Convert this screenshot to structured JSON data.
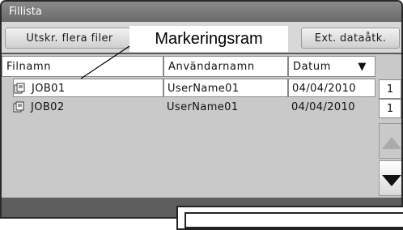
{
  "window": {
    "title": "Fillista"
  },
  "tabs": [
    {
      "label": "Utskr. flera filer"
    },
    {
      "label": "Ext. dataåtk."
    }
  ],
  "annotation": {
    "label": "Markeringsram"
  },
  "table": {
    "columns": [
      "Filnamn",
      "Användarnamn",
      "Datum"
    ],
    "sort_indicator": "▼",
    "rows": [
      {
        "filename": "JOB01",
        "user": "UserName01",
        "date": "04/04/2010",
        "selected": true
      },
      {
        "filename": "JOB02",
        "user": "UserName01",
        "date": "04/04/2010",
        "selected": false
      }
    ]
  },
  "pagination": {
    "current_page": "1",
    "total_pages": "1"
  },
  "scroll": {
    "up_icon": "triangle-up-icon",
    "down_icon": "triangle-down-icon"
  },
  "colors": {
    "titlebar": "#6a6a6a",
    "panel": "#c9c9c9",
    "footer": "#5e5e5e"
  }
}
